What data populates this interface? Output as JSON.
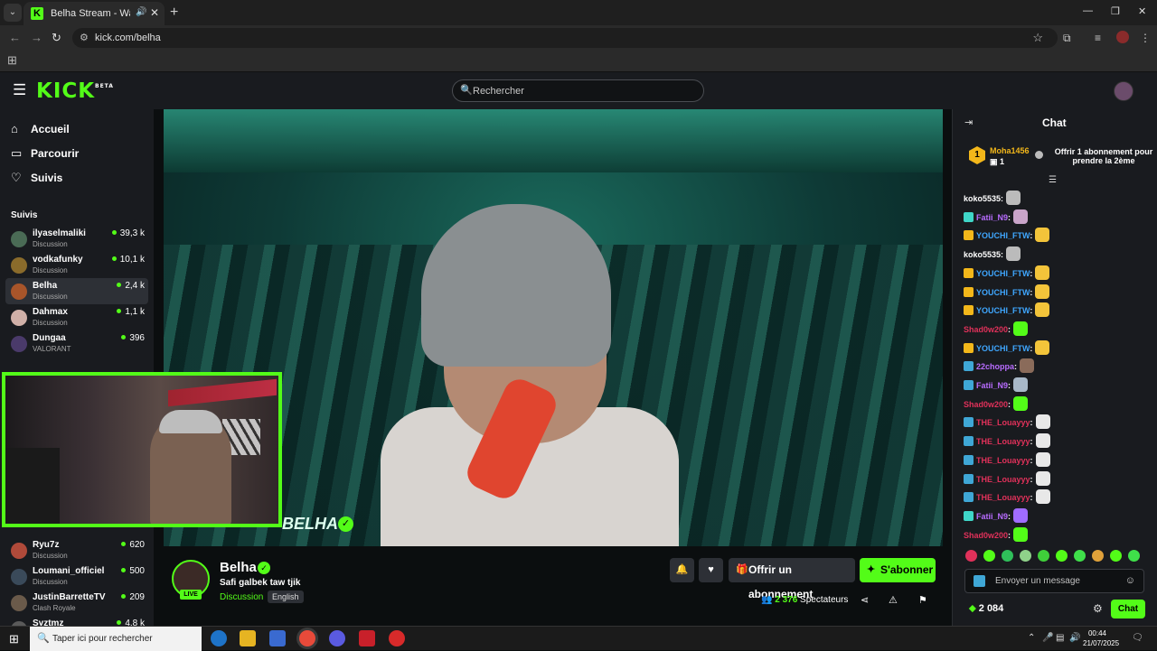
{
  "browser": {
    "tab_title": "Belha Stream - Watch Live o...",
    "url": "kick.com/belha"
  },
  "header": {
    "logo": "KICK",
    "logo_beta": "BETA",
    "search_placeholder": "Rechercher"
  },
  "nav": {
    "home": "Accueil",
    "browse": "Parcourir",
    "following": "Suivis"
  },
  "followed": {
    "title": "Suivis",
    "channels": [
      {
        "name": "ilyaselmaliki",
        "category": "Discussion",
        "viewers": "39,3 k",
        "color": "#4a6b55"
      },
      {
        "name": "vodkafunky",
        "category": "Discussion",
        "viewers": "10,1 k",
        "color": "#8a6b2b"
      },
      {
        "name": "Belha",
        "category": "Discussion",
        "viewers": "2,4 k",
        "color": "#a8552a"
      },
      {
        "name": "Dahmax",
        "category": "Discussion",
        "viewers": "1,1 k",
        "color": "#d0b0a8"
      },
      {
        "name": "Dungaa",
        "category": "VALORANT",
        "viewers": "396",
        "color": "#4a3a6a"
      },
      {
        "name": "Ryu7z",
        "category": "Discussion",
        "viewers": "620",
        "color": "#b04a3a"
      },
      {
        "name": "Loumani_officiel",
        "category": "Discussion",
        "viewers": "500",
        "color": "#3a4a5a"
      },
      {
        "name": "JustinBarretteTV",
        "category": "Clash Royale",
        "viewers": "209",
        "color": "#6a5a4a"
      },
      {
        "name": "Syztmz",
        "category": "",
        "viewers": "4,8 k",
        "color": "#5a5a5a"
      }
    ]
  },
  "stream": {
    "streamer": "Belha",
    "watermark": "BELHA",
    "live_label": "LIVE",
    "title": "Safi galbek taw tjik",
    "category": "Discussion",
    "language": "English",
    "viewers": "2 376",
    "viewers_label": "Spectateurs",
    "gift_label": "Offrir un abonnement",
    "subscribe_label": "S'abonner"
  },
  "chat": {
    "title": "Chat",
    "pinned_user": "Moha1456",
    "pinned_count": "1",
    "pinned_rank": "1",
    "pinned_offer": "Offrir 1 abonnement pour prendre la 2ème",
    "messages": [
      {
        "user": "koko5535",
        "color": "#ffffff",
        "badge": "",
        "emote": "#bbbbbb"
      },
      {
        "user": "Fatii_N9",
        "color": "#b86cff",
        "badge": "#3fd6c8",
        "emote": "#c9a4c9"
      },
      {
        "user": "YOUCHI_FTW",
        "color": "#3fa7ff",
        "badge": "#f3b71a",
        "emote": "#f3c43a"
      },
      {
        "user": "koko5535",
        "color": "#ffffff",
        "badge": "",
        "emote": "#bbbbbb"
      },
      {
        "user": "YOUCHI_FTW",
        "color": "#3fa7ff",
        "badge": "#f3b71a",
        "emote": "#f3c43a"
      },
      {
        "user": "YOUCHI_FTW",
        "color": "#3fa7ff",
        "badge": "#f3b71a",
        "emote": "#f3c43a"
      },
      {
        "user": "YOUCHI_FTW",
        "color": "#3fa7ff",
        "badge": "#f3b71a",
        "emote": "#f3c43a"
      },
      {
        "user": "Shad0w200",
        "color": "#e0315a",
        "badge": "",
        "emote": "#53fc18"
      },
      {
        "user": "YOUCHI_FTW",
        "color": "#3fa7ff",
        "badge": "#f3b71a",
        "emote": "#f3c43a"
      },
      {
        "user": "22choppa",
        "color": "#b86cff",
        "badge": "#3fa7d6",
        "emote": "#8a6b5a"
      },
      {
        "user": "Fatii_N9",
        "color": "#b86cff",
        "badge": "#3fa7d6",
        "emote": "#a8b8c8"
      },
      {
        "user": "Shad0w200",
        "color": "#e0315a",
        "badge": "",
        "emote": "#53fc18"
      },
      {
        "user": "THE_Louayyy",
        "color": "#e0315a",
        "badge": "#3fa7d6",
        "emote": "#e8e8e8"
      },
      {
        "user": "THE_Louayyy",
        "color": "#e0315a",
        "badge": "#3fa7d6",
        "emote": "#e8e8e8"
      },
      {
        "user": "THE_Louayyy",
        "color": "#e0315a",
        "badge": "#3fa7d6",
        "emote": "#e8e8e8"
      },
      {
        "user": "THE_Louayyy",
        "color": "#e0315a",
        "badge": "#3fa7d6",
        "emote": "#e8e8e8"
      },
      {
        "user": "THE_Louayyy",
        "color": "#e0315a",
        "badge": "#3fa7d6",
        "emote": "#e8e8e8"
      },
      {
        "user": "Fatii_N9",
        "color": "#b86cff",
        "badge": "#3fd6c8",
        "emote": "#a06cff"
      },
      {
        "user": "Shad0w200",
        "color": "#e0315a",
        "badge": "",
        "emote": "#53fc18"
      }
    ],
    "input_placeholder": "Envoyer un message",
    "points": "2 084",
    "send_label": "Chat"
  },
  "taskbar": {
    "search_placeholder": "Taper ici pour rechercher",
    "time": "00:44",
    "date": "21/07/2025"
  }
}
